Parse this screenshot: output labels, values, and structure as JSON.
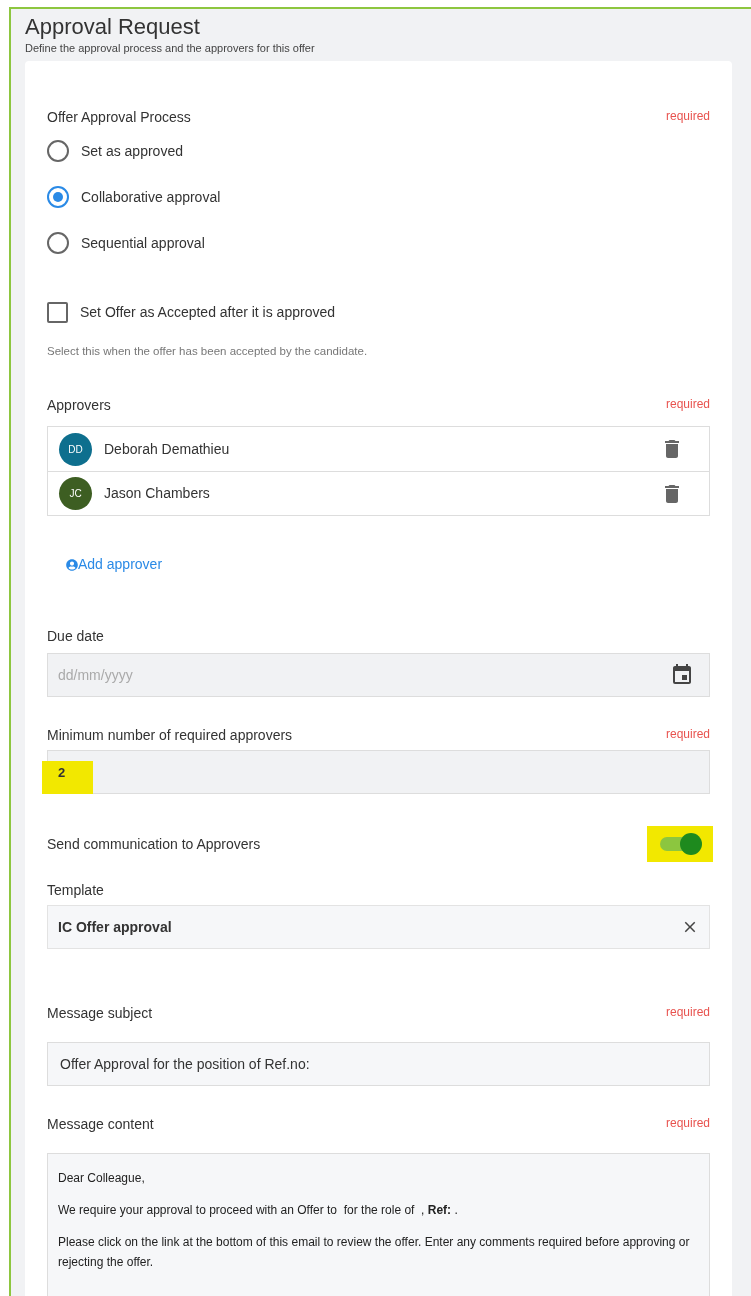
{
  "header": {
    "title": "Approval Request",
    "subtitle": "Define the approval process and the approvers for this offer"
  },
  "process": {
    "label": "Offer Approval Process",
    "required": "required",
    "options": [
      {
        "label": "Set as approved",
        "selected": false
      },
      {
        "label": "Collaborative approval",
        "selected": true
      },
      {
        "label": "Sequential approval",
        "selected": false
      }
    ]
  },
  "accepted_checkbox": {
    "label": "Set Offer as Accepted after it is approved",
    "checked": false,
    "hint": "Select this when the offer has been accepted by the candidate."
  },
  "approvers": {
    "label": "Approvers",
    "required": "required",
    "items": [
      {
        "initials": "DD",
        "name": "Deborah Demathieu",
        "color": "#0e6f8e"
      },
      {
        "initials": "JC",
        "name": "Jason Chambers",
        "color": "#3d5e22"
      }
    ],
    "add_link": "Add approver"
  },
  "due_date": {
    "label": "Due date",
    "placeholder": "dd/mm/yyyy"
  },
  "min_approvers": {
    "label": "Minimum number of required approvers",
    "required": "required",
    "value": "2",
    "highlighted": true
  },
  "send_communication": {
    "label": "Send communication to Approvers",
    "on": true,
    "highlighted": true
  },
  "template": {
    "label": "Template",
    "value": "IC Offer approval"
  },
  "message_subject": {
    "label": "Message subject",
    "required": "required",
    "value": "Offer Approval for the position of Ref.no:"
  },
  "message_content": {
    "label": "Message content",
    "required": "required",
    "paragraphs": [
      "Dear Colleague,",
      "We require your approval to proceed with an Offer to  for the role of  , **Ref:** .",
      "Please click on the link at the bottom of this email to review the offer. Enter any comments required before approving or rejecting the offer."
    ]
  }
}
